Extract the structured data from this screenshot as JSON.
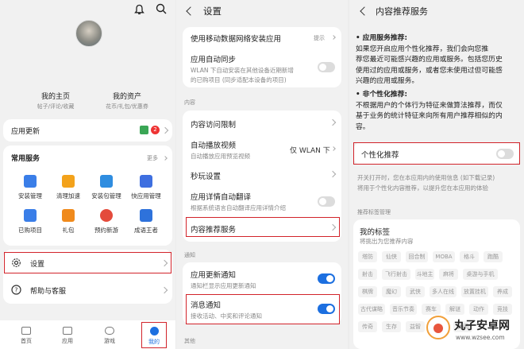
{
  "left": {
    "my_home": "我的主页",
    "my_home_sub": "帖子/评论/收藏",
    "my_assets": "我的资产",
    "my_assets_sub": "花币/礼包/优惠券",
    "app_update": "应用更新",
    "app_update_count": "2",
    "common_services": "常用服务",
    "more": "更多",
    "services": [
      {
        "label": "安装管理",
        "color": "#3a7ee8"
      },
      {
        "label": "清理加速",
        "color": "#f3a21b"
      },
      {
        "label": "安装包管理",
        "color": "#2f8de0"
      },
      {
        "label": "快应用管理",
        "color": "#3e6fe0"
      },
      {
        "label": "已购项目",
        "color": "#3a7ee8"
      },
      {
        "label": "礼包",
        "color": "#f08a1c"
      },
      {
        "label": "预约新游",
        "color": "#e44b3c"
      },
      {
        "label": "成语王者",
        "color": "#2e72db"
      }
    ],
    "settings": "设置",
    "help": "帮助与客服",
    "nav": [
      "首页",
      "应用",
      "游戏",
      "我的"
    ]
  },
  "middle": {
    "title": "设置",
    "rows": {
      "mobile_install": "使用移动数据网络安装应用",
      "mobile_install_value": "提示",
      "auto_sync": "应用自动同步",
      "auto_sync_sub1": "WLAN 下自动安装在其他设备近期新增",
      "auto_sync_sub2": "的已购项目 (同步适配本设备的项目)",
      "section_content": "内容",
      "content_restrict": "内容访问限制",
      "autoplay": "自动播放视频",
      "autoplay_sub": "自动播放应用预览视频",
      "autoplay_value": "仅 WLAN 下",
      "instant": "秒玩设置",
      "translate": "应用详情自动翻译",
      "translate_sub": "根据系统语言自动翻译应用详情介绍",
      "recommend": "内容推荐服务",
      "section_notify": "通知",
      "update_notify": "应用更新通知",
      "update_notify_sub": "通知栏显示应用更新通知",
      "msg_notify": "消息通知",
      "msg_notify_sub": "接收活动、中奖和评论通知",
      "section_other": "其他"
    }
  },
  "right": {
    "title": "内容推荐服务",
    "top_clip": "要求",
    "app_rec_title": "• 应用服务推荐:",
    "app_rec_lines": [
      "如果您开启应用个性化推荐，我们会向您推",
      "荐您最近可能感兴趣的应用或服务。包括您历史",
      "使用过的应用或服务，或者您未使用过但可能感",
      "兴趣的应用或服务。"
    ],
    "non_personal_title": "• 非个性化推荐:",
    "non_personal_lines": [
      "不根据用户的个体行为特征来做算法推荐，而仅",
      "基于业务的统计特征来向所有用户推荐相似的内",
      "容。"
    ],
    "personal_rec": "个性化推荐",
    "desc_lines": [
      "开关打开时，您在本应用内的使用信息 (如下载记录)",
      "将用于个性化内容推荐，以提升您在本应用的体验"
    ],
    "tag_mgmt": "推荐标签管理",
    "my_tags": "我的标签",
    "my_tags_sub": "将挑出为您推荐内容",
    "tags": [
      "塔防",
      "仙侠",
      "回合制",
      "MOBA",
      "格斗",
      "跑酷",
      "射击",
      "飞行射击",
      "斗地主",
      "麻将",
      "桌游与手机",
      "棋牌",
      "魔幻",
      "武侠",
      "多人在线",
      "放置挂机",
      "养成",
      "古代谋略",
      "音乐节奏",
      "赛车",
      "解谜",
      "动作",
      "竞技",
      "传奇",
      "生存",
      "益智",
      "冒险",
      "休闲"
    ],
    "watermark": "丸子安卓网",
    "watermark_url": "www.wzsee.com"
  }
}
